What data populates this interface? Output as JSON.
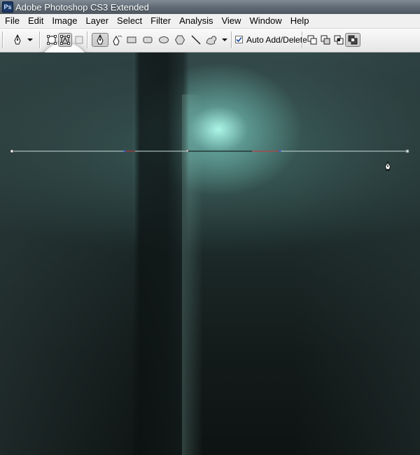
{
  "window": {
    "app_icon_text": "Ps",
    "title": "Adobe Photoshop CS3 Extended"
  },
  "menu": [
    "File",
    "Edit",
    "Image",
    "Layer",
    "Select",
    "Filter",
    "Analysis",
    "View",
    "Window",
    "Help"
  ],
  "options_bar": {
    "tools": {
      "pen_tool": "pen-icon",
      "tool_preset_dropdown": "chevron-down-icon",
      "shape_layers_mode": "shape-layers-icon",
      "paths_mode": "paths-icon",
      "fill_pixels_mode": "fill-pixels-icon",
      "pen": "pen-icon",
      "freeform_pen": "freeform-pen-icon",
      "rectangle": "rectangle-icon",
      "rounded_rectangle": "rounded-rectangle-icon",
      "ellipse": "ellipse-icon",
      "polygon": "polygon-icon",
      "line": "line-icon",
      "custom_shape": "custom-shape-icon",
      "custom_shape_dropdown": "chevron-down-icon",
      "add_to_path": "add-to-path-icon",
      "subtract_from_path": "subtract-from-path-icon",
      "intersect_path": "intersect-path-icon",
      "exclude_overlap": "exclude-overlap-icon"
    },
    "auto_add_delete": {
      "label": "Auto Add/Delete",
      "checked": true
    }
  },
  "canvas": {
    "path_stroke_color": "#c8dcdc",
    "highlight_color": "#8fe9da"
  }
}
